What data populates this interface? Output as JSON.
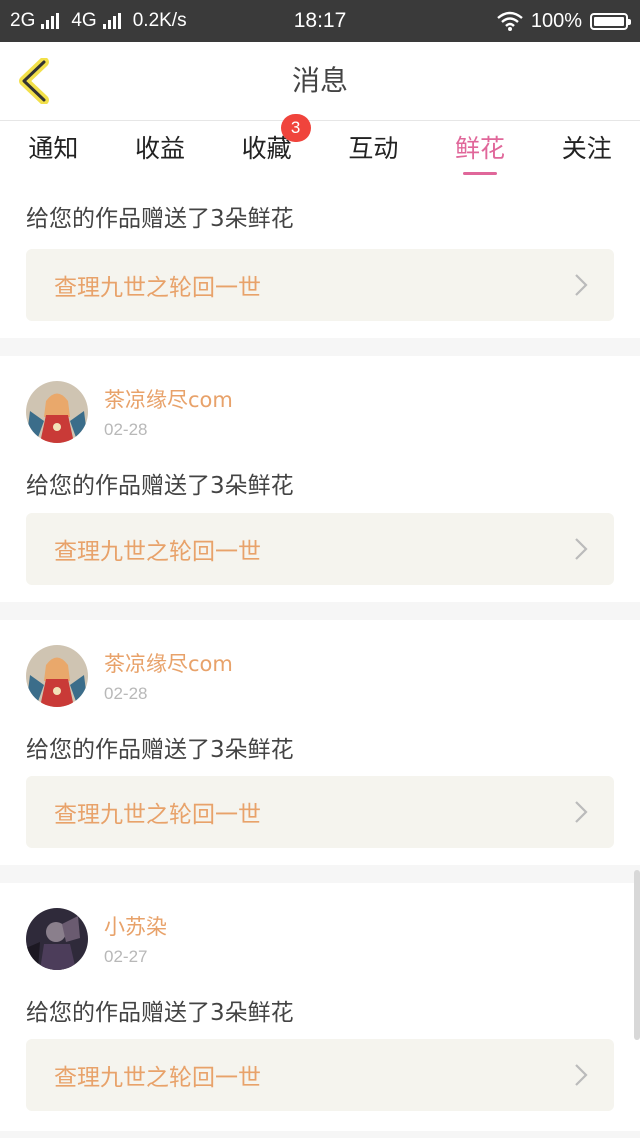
{
  "status_bar": {
    "network1": "2G",
    "network2": "4G",
    "speed": "0.2K/s",
    "time": "18:17",
    "battery": "100%"
  },
  "header": {
    "title": "消息"
  },
  "tabs": [
    {
      "label": "通知",
      "active": false
    },
    {
      "label": "收益",
      "active": false
    },
    {
      "label": "收藏",
      "active": false,
      "badge": "3"
    },
    {
      "label": "互动",
      "active": false
    },
    {
      "label": "鲜花",
      "active": true
    },
    {
      "label": "关注",
      "active": false
    }
  ],
  "messages": [
    {
      "message": "给您的作品赠送了3朵鲜花",
      "work_title": "查理九世之轮回一世"
    },
    {
      "user": "茶凉缘尽com",
      "date": "02-28",
      "message": "给您的作品赠送了3朵鲜花",
      "work_title": "查理九世之轮回一世"
    },
    {
      "user": "茶凉缘尽com",
      "date": "02-28",
      "message": "给您的作品赠送了3朵鲜花",
      "work_title": "查理九世之轮回一世"
    },
    {
      "user": "小苏染",
      "date": "02-27",
      "message": "给您的作品赠送了3朵鲜花",
      "work_title": "查理九世之轮回一世"
    }
  ],
  "colors": {
    "accent": "#e0679a",
    "username": "#e8a26a",
    "badge": "#f0443c",
    "work_bg": "#f5f4ee"
  }
}
